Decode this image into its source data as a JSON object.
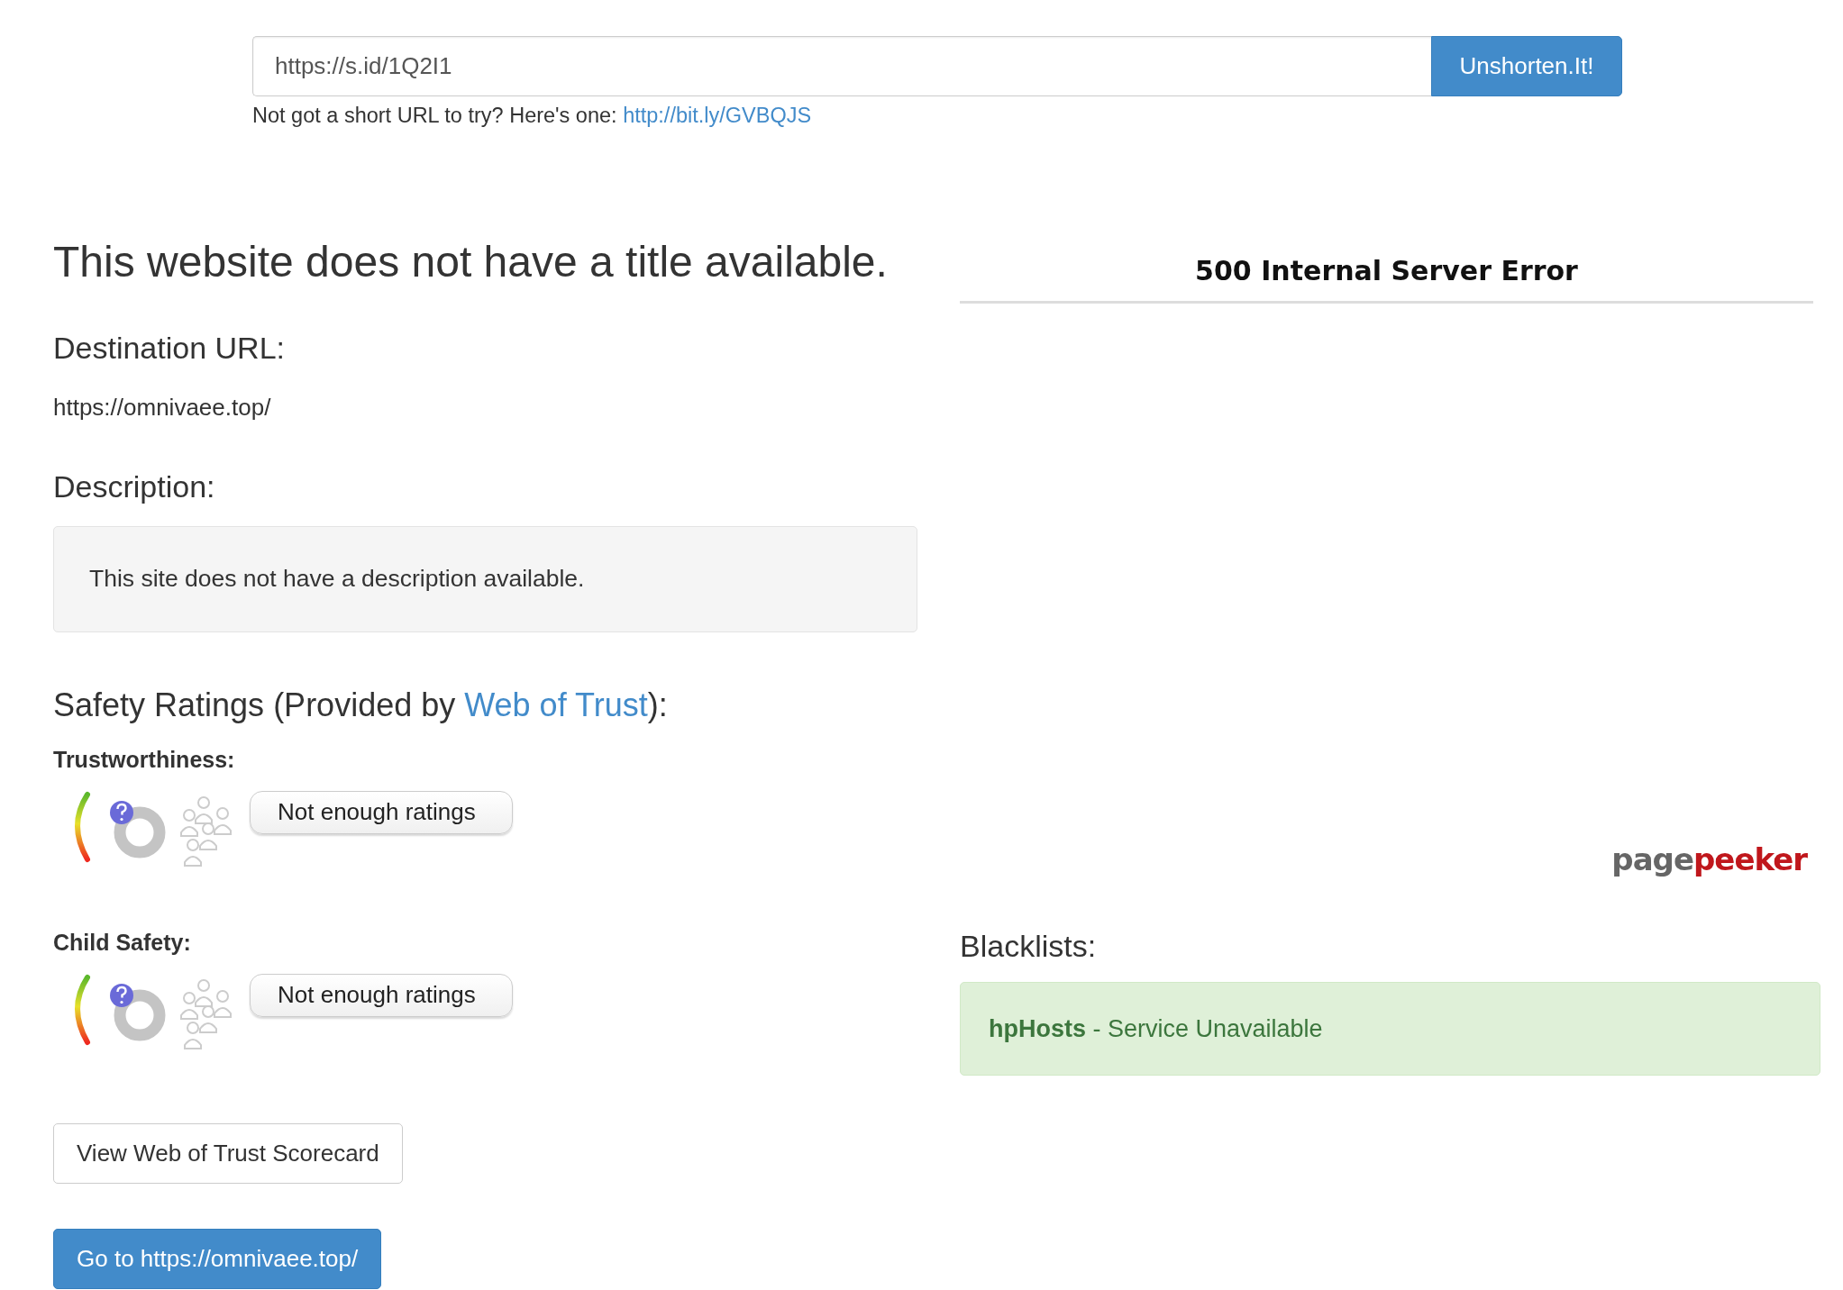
{
  "search": {
    "value": "https://s.id/1Q2I1",
    "button": "Unshorten.It!"
  },
  "hint": {
    "text": "Not got a short URL to try? Here's one:",
    "link": "http://bit.ly/GVBQJS"
  },
  "result": {
    "title": "This website does not have a title available.",
    "destination_label": "Destination URL:",
    "destination_url": "https://omnivaee.top/",
    "description_label": "Description:",
    "description": "This site does not have a description available."
  },
  "safety": {
    "heading_before": "Safety Ratings (Provided by",
    "heading_link": "Web of Trust",
    "heading_after": "):",
    "ratings": [
      {
        "label": "Trustworthiness:",
        "status": "Not enough ratings"
      },
      {
        "label": "Child Safety:",
        "status": "Not enough ratings"
      }
    ]
  },
  "buttons": {
    "scorecard": "View Web of Trust Scorecard",
    "go": "Go to https://omnivaee.top/"
  },
  "preview": {
    "error": "500 Internal Server Error",
    "logo": [
      "page",
      "peeker"
    ]
  },
  "blacklists": {
    "heading": "Blacklists:",
    "items": [
      {
        "text": "**hpHosts** - Service Unavailable"
      }
    ]
  }
}
